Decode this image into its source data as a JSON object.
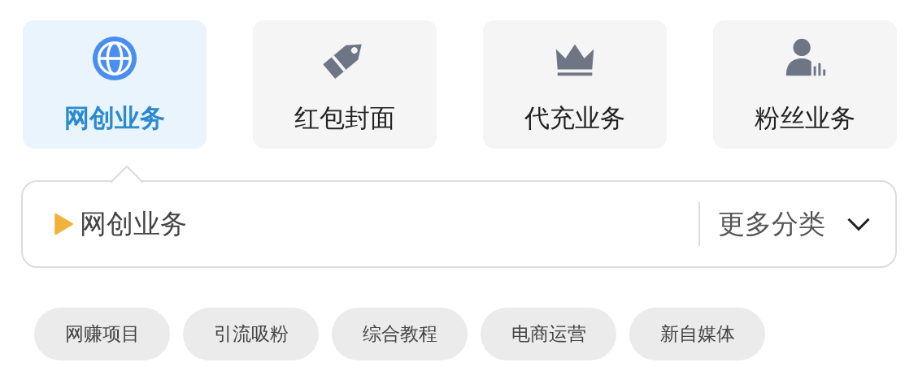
{
  "categories": [
    {
      "label": "网创业务",
      "selected": true
    },
    {
      "label": "红包封面",
      "selected": false
    },
    {
      "label": "代充业务",
      "selected": false
    },
    {
      "label": "粉丝业务",
      "selected": false
    }
  ],
  "current": {
    "label": "网创业务",
    "more": "更多分类"
  },
  "tags": [
    "网赚项目",
    "引流吸粉",
    "综合教程",
    "电商运营",
    "新自媒体"
  ]
}
